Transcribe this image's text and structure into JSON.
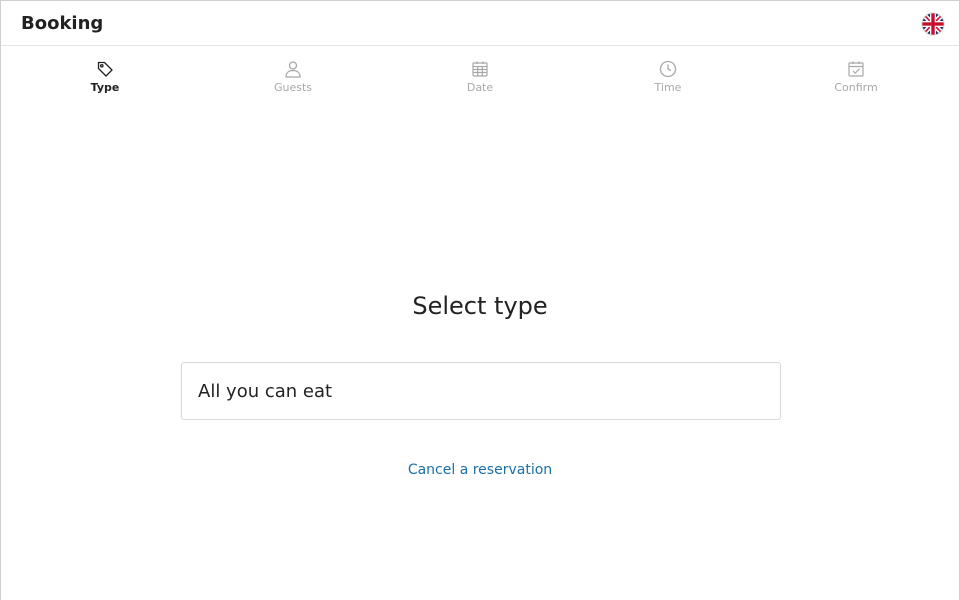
{
  "header": {
    "title": "Booking",
    "language_icon": "uk-flag-icon"
  },
  "steps": [
    {
      "label": "Type",
      "icon": "tag-icon",
      "active": true
    },
    {
      "label": "Guests",
      "icon": "user-icon",
      "active": false
    },
    {
      "label": "Date",
      "icon": "calendar-icon",
      "active": false
    },
    {
      "label": "Time",
      "icon": "clock-icon",
      "active": false
    },
    {
      "label": "Confirm",
      "icon": "calendar-check-icon",
      "active": false
    }
  ],
  "main": {
    "title": "Select type",
    "options": [
      {
        "label": "All you can eat"
      }
    ],
    "cancel_link": "Cancel a reservation"
  },
  "colors": {
    "link": "#1a6fa6",
    "active_step": "#222222",
    "inactive_step": "#a8a8a8",
    "border": "#d9d9d9"
  }
}
